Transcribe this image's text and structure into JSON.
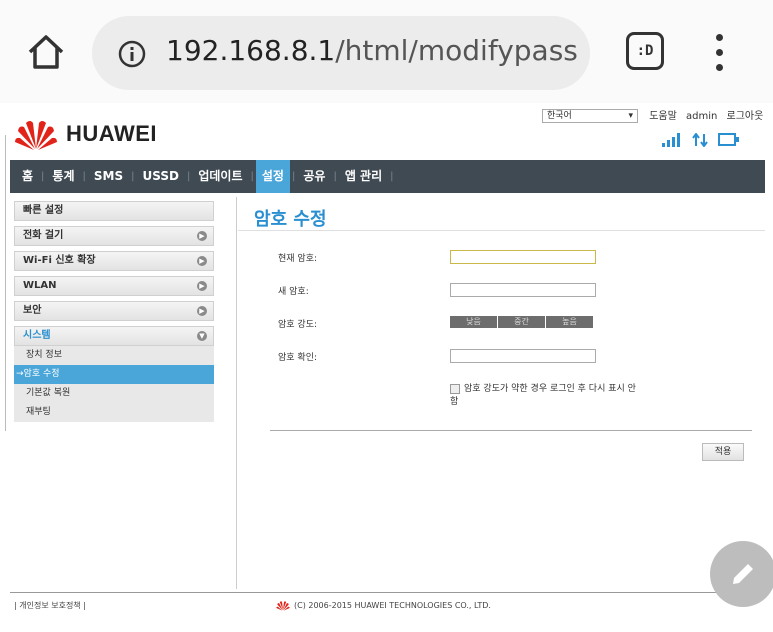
{
  "browser": {
    "url_host": "192.168.8.1",
    "url_path": "/html/modifypass",
    "tab_label": ":D"
  },
  "header": {
    "language": "한국어",
    "help": "도움말",
    "user": "admin",
    "logout": "로그아웃",
    "brand": "HUAWEI"
  },
  "nav": {
    "items": [
      "홈",
      "통계",
      "SMS",
      "USSD",
      "업데이트",
      "설정",
      "공유",
      "앱 관리"
    ],
    "active": "설정"
  },
  "sidebar": {
    "items": [
      {
        "label": "빠른 설정"
      },
      {
        "label": "전화 걸기"
      },
      {
        "label": "Wi-Fi 신호 확장"
      },
      {
        "label": "WLAN"
      },
      {
        "label": "보안"
      },
      {
        "label": "시스템"
      }
    ],
    "sub_items": [
      {
        "label": "장치 정보"
      },
      {
        "label": "→암호 수정"
      },
      {
        "label": "기본값 복원"
      },
      {
        "label": "재부팅"
      }
    ]
  },
  "form": {
    "title": "암호 수정",
    "current_label": "현재 암호:",
    "new_label": "새 암호:",
    "strength_label": "암호 강도:",
    "strength_levels": [
      "낮음",
      "중간",
      "높음"
    ],
    "confirm_label": "암호 확인:",
    "checkbox_text": "암호 강도가 약한 경우 로그인 후 다시 표시 안 함",
    "apply": "적용"
  },
  "footer": {
    "privacy": "| 개인정보 보호정책 |",
    "copyright": "(C) 2006-2015 HUAWEI TECHNOLOGIES CO., LTD."
  },
  "colors": {
    "accent": "#4aa6d9",
    "navbar": "#404a53",
    "brand_red": "#e2231a"
  }
}
